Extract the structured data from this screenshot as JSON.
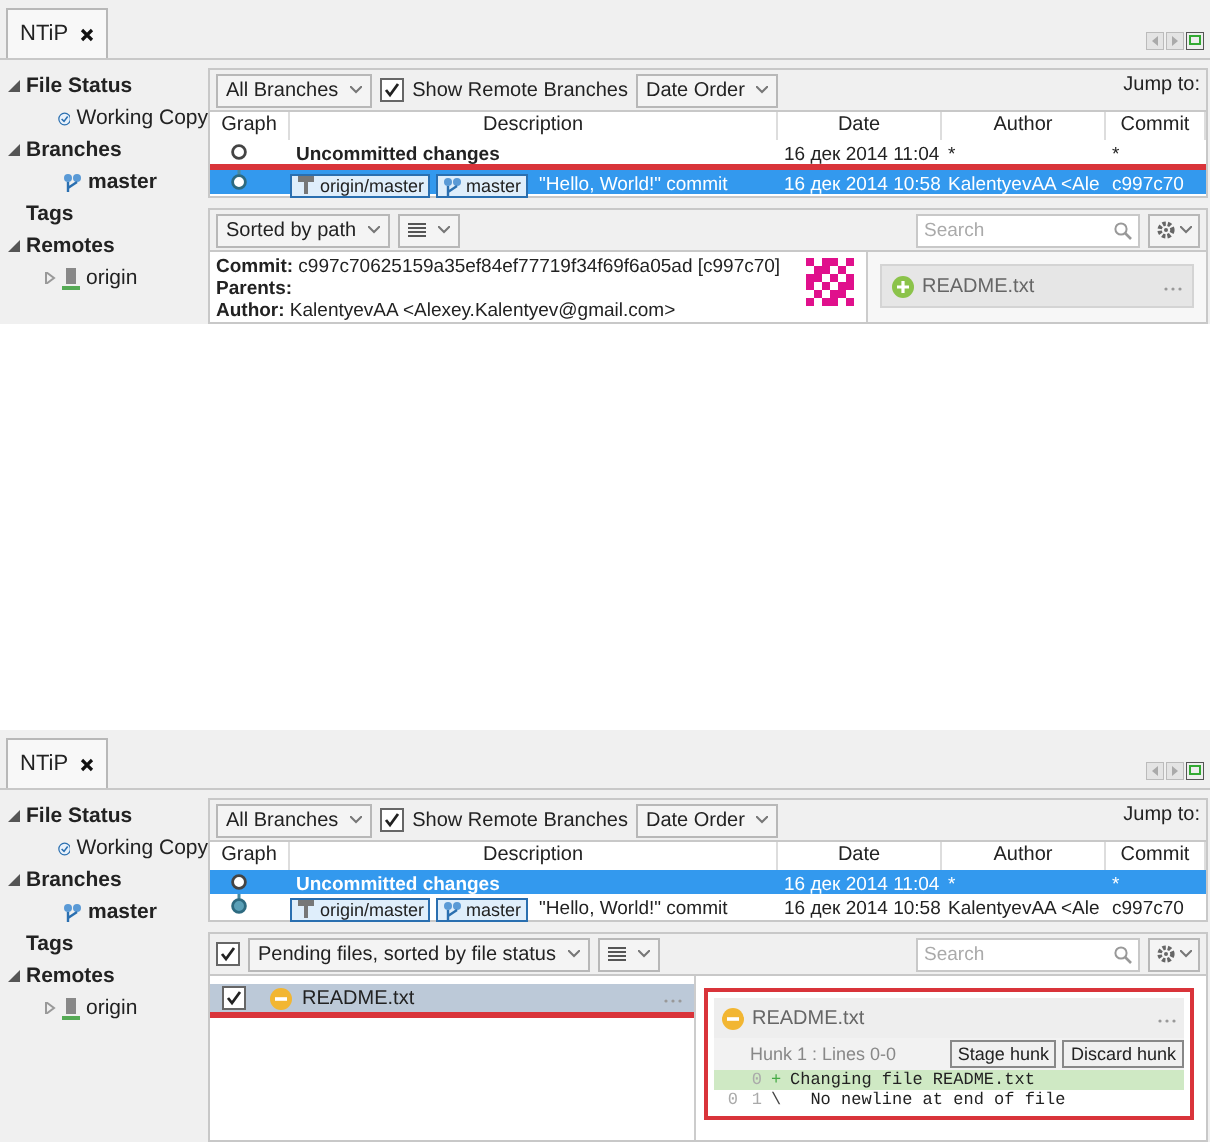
{
  "screens": [
    {
      "tab": {
        "label": "NTiP",
        "selected": true
      },
      "sidebar": [
        {
          "label": "File Status",
          "expanded": true,
          "children": [
            {
              "label": "Working Copy",
              "kind": "check"
            }
          ]
        },
        {
          "label": "Branches",
          "expanded": true,
          "children": [
            {
              "label": "master",
              "kind": "branch",
              "bold": true
            }
          ]
        },
        {
          "label": "Tags"
        },
        {
          "label": "Remotes",
          "expanded": true,
          "children": [
            {
              "label": "origin",
              "kind": "remote",
              "expanded": false
            }
          ]
        }
      ],
      "toolbar": {
        "branches": "All Branches",
        "show_remote": {
          "label": "Show Remote Branches",
          "checked": true
        },
        "order": "Date Order",
        "jump": "Jump to:"
      },
      "columns": [
        "Graph",
        "Description",
        "Date",
        "Author",
        "Commit"
      ],
      "rows": [
        {
          "selected": false,
          "highlighted": true,
          "description": "Uncommitted changes",
          "bold": true,
          "date": "16 дек 2014 11:04",
          "author": "*",
          "commit": "*"
        },
        {
          "selected": true,
          "highlighted": false,
          "refs": [
            {
              "label": "origin/master",
              "kind": "remote"
            },
            {
              "label": "master",
              "kind": "local"
            }
          ],
          "description": "\"Hello, World!\" commit",
          "bold": false,
          "date": "16 дек 2014 10:58",
          "author": "KalentyevAA <Ale",
          "commit": "c997c70"
        }
      ],
      "lower": {
        "kind": "commit",
        "sort": "Sorted by path",
        "search": {
          "placeholder": "Search"
        },
        "details": [
          {
            "label": "Commit:",
            "value": "c997c70625159a35ef84ef77719f34f69f6a05ad [c997c70]"
          },
          {
            "label": "Parents:"
          },
          {
            "label": "Author:",
            "value": "KalentyevAA <Alexey.Kalentyev@gmail.com>"
          }
        ],
        "files": [
          {
            "name": "README.txt",
            "kind": "added"
          }
        ]
      }
    },
    {
      "tab": {
        "label": "NTiP",
        "selected": true
      },
      "sidebar": [
        {
          "label": "File Status",
          "expanded": true,
          "children": [
            {
              "label": "Working Copy",
              "kind": "check"
            }
          ]
        },
        {
          "label": "Branches",
          "expanded": true,
          "children": [
            {
              "label": "master",
              "kind": "branch",
              "bold": true
            }
          ]
        },
        {
          "label": "Tags"
        },
        {
          "label": "Remotes",
          "expanded": true,
          "children": [
            {
              "label": "origin",
              "kind": "remote",
              "expanded": false
            }
          ]
        }
      ],
      "toolbar": {
        "branches": "All Branches",
        "show_remote": {
          "label": "Show Remote Branches",
          "checked": true
        },
        "order": "Date Order",
        "jump": "Jump to:"
      },
      "columns": [
        "Graph",
        "Description",
        "Date",
        "Author",
        "Commit"
      ],
      "rows": [
        {
          "selected": true,
          "highlighted": false,
          "description": "Uncommitted changes",
          "bold": true,
          "date": "16 дек 2014 11:04",
          "author": "*",
          "commit": "*"
        },
        {
          "selected": false,
          "highlighted": false,
          "refs": [
            {
              "label": "origin/master",
              "kind": "remote"
            },
            {
              "label": "master",
              "kind": "local"
            }
          ],
          "description": "\"Hello, World!\" commit",
          "bold": false,
          "date": "16 дек 2014 10:58",
          "author": "KalentyevAA <Ale",
          "commit": "c997c70"
        }
      ],
      "lower": {
        "kind": "pending",
        "all_checked": true,
        "sort": "Pending files, sorted by file status",
        "search": {
          "placeholder": "Search"
        },
        "files": [
          {
            "name": "README.txt",
            "kind": "modified",
            "checked": true,
            "selected": true,
            "highlighted": true
          }
        ],
        "diff": {
          "file": "README.txt",
          "kind": "modified",
          "highlighted": true,
          "hunk": "Hunk 1 : Lines 0-0",
          "buttons": [
            "Stage hunk",
            "Discard hunk"
          ],
          "lines": [
            {
              "new": "0",
              "sign": "+",
              "text": "Changing file README.txt",
              "kind": "added"
            },
            {
              "old": "0",
              "new": "1",
              "sign": "\\",
              "text": "  No newline at end of file",
              "kind": "context"
            }
          ]
        }
      }
    }
  ]
}
